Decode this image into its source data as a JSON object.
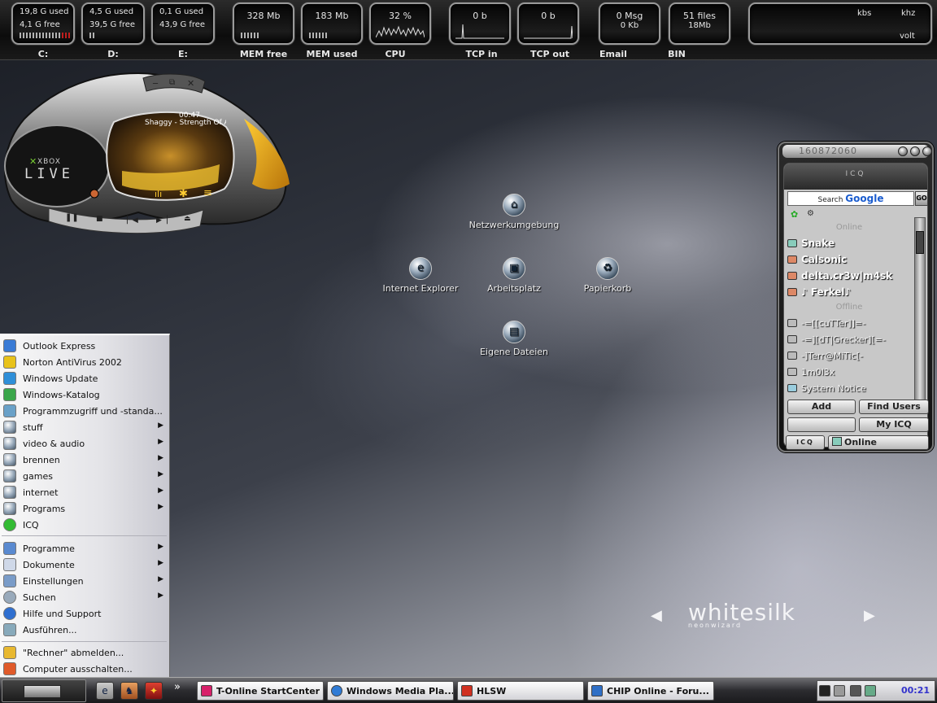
{
  "topbar": {
    "drives": [
      {
        "used": "19,8 G used",
        "free": "4,1 G free",
        "label": "C:"
      },
      {
        "used": "4,5 G used",
        "free": "39,5 G free",
        "label": "D:"
      },
      {
        "used": "0,1 G used",
        "free": "43,9 G free",
        "label": "E:"
      }
    ],
    "mem_free": {
      "value": "328 Mb",
      "label": "MEM free"
    },
    "mem_used": {
      "value": "183 Mb",
      "label": "MEM used"
    },
    "cpu": {
      "value": "32 %",
      "label": "CPU"
    },
    "tcp_in": {
      "value": "0 b",
      "label": "TCP in"
    },
    "tcp_out": {
      "value": "0 b",
      "label": "TCP out"
    },
    "email": {
      "line1": "0 Msg",
      "line2": "0 Kb",
      "label": "Email"
    },
    "bin": {
      "line1": "51 files",
      "line2": "18Mb",
      "label": "BIN"
    },
    "system": {
      "kbs": "kbs",
      "khz": "khz",
      "volt": "volt"
    }
  },
  "player": {
    "time": "00:47",
    "track": "Shaggy - Strength Of A",
    "brand_small": "XBOX",
    "brand_big": "LIVE"
  },
  "desktop": {
    "icons": [
      {
        "label": "Netzwerkumgebung",
        "icon": "network-icon"
      },
      {
        "label": "Internet Explorer",
        "icon": "ie-icon"
      },
      {
        "label": "Arbeitsplatz",
        "icon": "computer-icon"
      },
      {
        "label": "Papierkorb",
        "icon": "recycle-bin-icon"
      },
      {
        "label": "Eigene Dateien",
        "icon": "documents-icon"
      }
    ],
    "brand": {
      "main": "whitesilk",
      "sub": "neonwizard"
    }
  },
  "icq": {
    "uin": "160872060",
    "logo": "ICQ",
    "search_prefix": "Search",
    "search_brand": "Google",
    "search_go": "GO",
    "online_header": "Online",
    "offline_header": "Offline",
    "online": [
      "Snake",
      "Calsonic",
      "delta.cr3w|m4sk",
      "♪ Ferkel♪"
    ],
    "offline": [
      "-=[[cuTTer]]=-",
      "-=][dT|Grecker][=-",
      "-]Terr@MiTic[-",
      "1m0l3x"
    ],
    "system_notice": "System Notice",
    "btn_add": "Add",
    "btn_find": "Find Users",
    "btn_myicq": "My ICQ",
    "btn_status": "Online",
    "btn_logo": "ICQ"
  },
  "startmenu": {
    "pinned": [
      {
        "label": "Outlook Express",
        "color": "#3a7bd5"
      },
      {
        "label": "Norton AntiVirus 2002",
        "color": "#e8c21a"
      },
      {
        "label": "Windows Update",
        "color": "#2f8fd8"
      },
      {
        "label": "Windows-Katalog",
        "color": "#3aa64a"
      },
      {
        "label": "Programmzugriff und -standa...",
        "color": "#6aa1c8"
      }
    ],
    "groups": [
      {
        "label": "stuff",
        "arrow": "▶"
      },
      {
        "label": "video & audio",
        "arrow": "▶"
      },
      {
        "label": "brennen",
        "arrow": "▶"
      },
      {
        "label": "games",
        "arrow": "▶"
      },
      {
        "label": "internet",
        "arrow": "▶"
      },
      {
        "label": "Programs",
        "arrow": "▶"
      },
      {
        "label": "ICQ",
        "arrow": ""
      }
    ],
    "system": [
      {
        "label": "Programme",
        "arrow": "▶"
      },
      {
        "label": "Dokumente",
        "arrow": "▶"
      },
      {
        "label": "Einstellungen",
        "arrow": "▶"
      },
      {
        "label": "Suchen",
        "arrow": "▶"
      },
      {
        "label": "Hilfe und Support",
        "arrow": ""
      },
      {
        "label": "Ausführen...",
        "arrow": ""
      }
    ],
    "logoff": "\"Rechner\" abmelden...",
    "shutdown": "Computer ausschalten..."
  },
  "taskbar": {
    "overflow": "»",
    "tasks": [
      {
        "label": "T-Online StartCenter",
        "color": "#d8206a"
      },
      {
        "label": "Windows Media Pla...",
        "color": "#2f7bd6"
      },
      {
        "label": "HLSW",
        "color": "#d03020"
      },
      {
        "label": "CHIP Online - Foru...",
        "color": "#2f6fc6"
      }
    ],
    "clock": "00:21"
  }
}
